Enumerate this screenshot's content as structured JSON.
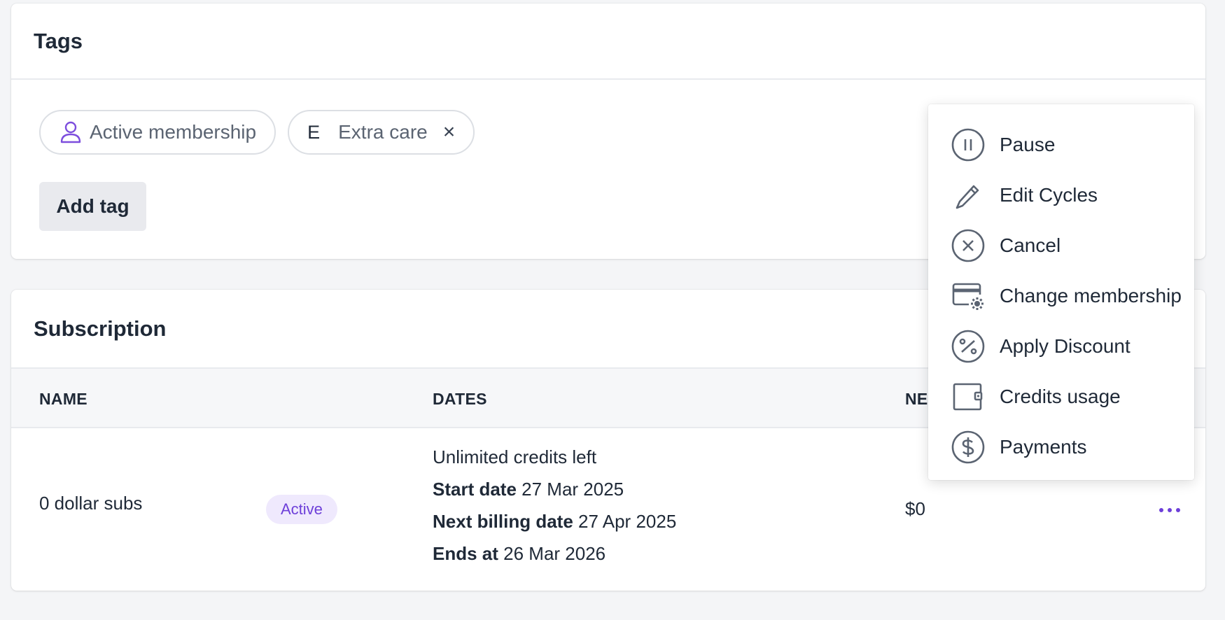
{
  "tags": {
    "title": "Tags",
    "chips": [
      {
        "label": "Active membership",
        "icon": "user-icon"
      },
      {
        "letter": "E",
        "label": "Extra care",
        "remove": "×"
      }
    ],
    "add_tag_label": "Add tag"
  },
  "subscription": {
    "title": "Subscription",
    "columns": {
      "name": "NAME",
      "dates": "DATES",
      "next": "NE"
    },
    "row": {
      "name": "0 dollar subs",
      "status": "Active",
      "credits": "Unlimited credits left",
      "start_label": "Start date",
      "start_value": "27 Mar 2025",
      "next_billing_label": "Next billing date",
      "next_billing_value": "27 Apr 2025",
      "ends_label": "Ends at",
      "ends_value": "26 Mar 2026",
      "amount": "$0"
    }
  },
  "menu": {
    "items": [
      {
        "label": "Pause",
        "icon": "pause-circle-icon"
      },
      {
        "label": "Edit Cycles",
        "icon": "pencil-icon"
      },
      {
        "label": "Cancel",
        "icon": "x-circle-icon"
      },
      {
        "label": "Change membership",
        "icon": "card-settings-icon"
      },
      {
        "label": "Apply Discount",
        "icon": "percent-circle-icon"
      },
      {
        "label": "Credits usage",
        "icon": "wallet-icon"
      },
      {
        "label": "Payments",
        "icon": "dollar-circle-icon"
      }
    ]
  },
  "colors": {
    "accent": "#6d3fd9",
    "badge_bg": "#efe9fd",
    "icon_gray": "#5b6472"
  }
}
